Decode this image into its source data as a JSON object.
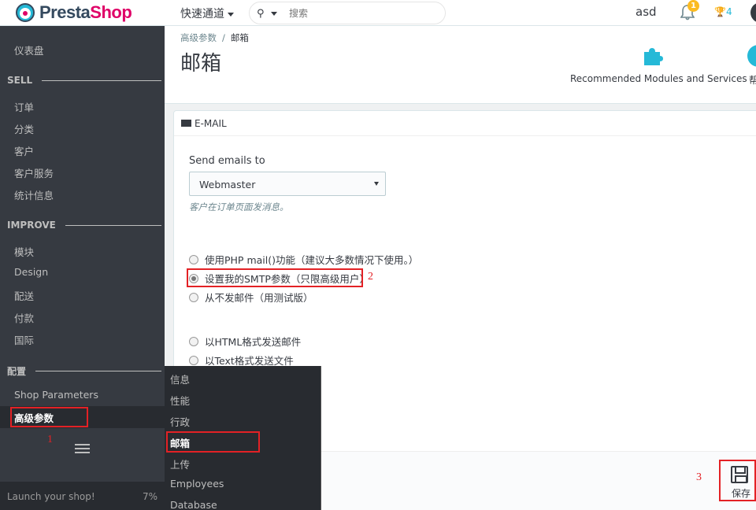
{
  "header": {
    "logo_part1": "Presta",
    "logo_part2": "Shop",
    "quick_access": "快速通道",
    "search_placeholder": "搜索",
    "user": "asd",
    "notifications_count": "1",
    "trophy_count": "4"
  },
  "sidebar": {
    "dashboard": "仪表盘",
    "sections": {
      "sell": "SELL",
      "improve": "IMPROVE",
      "configure": "配置"
    },
    "sell_items": [
      "订单",
      "分类",
      "客户",
      "客户服务",
      "统计信息"
    ],
    "improve_items": [
      "模块",
      "Design",
      "配送",
      "付款",
      "国际"
    ],
    "configure_items": [
      "Shop Parameters",
      "高级参数"
    ],
    "launch_label": "Launch your shop!",
    "launch_progress": "7%"
  },
  "submenu": {
    "items": [
      "信息",
      "性能",
      "行政",
      "邮箱",
      "上传",
      "Employees",
      "Database"
    ],
    "active_index": 3
  },
  "page": {
    "breadcrumb_parent": "高级参数",
    "breadcrumb_sep": "/",
    "breadcrumb_current": "邮箱",
    "title": "邮箱",
    "recommended": "Recommended Modules and Services",
    "help_partial": "帮"
  },
  "panel": {
    "header": "E-MAIL",
    "send_label": "Send emails to",
    "send_value": "Webmaster",
    "send_help": "客户在订单页面发消息。",
    "method_options": [
      {
        "label": "使用PHP mail()功能（建议大多数情况下使用。）",
        "checked": false
      },
      {
        "label": "设置我的SMTP参数（只限高级用户）",
        "checked": true
      },
      {
        "label": "从不发邮件（用测试版）",
        "checked": false
      }
    ],
    "format_options": [
      {
        "label": "以HTML格式发送邮件",
        "checked": false
      },
      {
        "label": "以Text格式发送文件",
        "checked": false
      }
    ],
    "save_label": "保存"
  },
  "annotations": [
    "1",
    "2",
    "3"
  ],
  "colors": {
    "accent": "#25b9d7",
    "brand": "#df0067",
    "sidebar": "#363a41",
    "annotation": "#e32125"
  }
}
